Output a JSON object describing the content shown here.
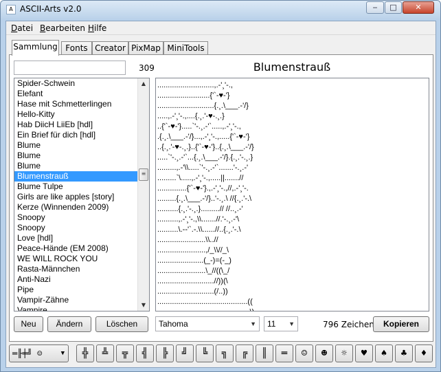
{
  "window": {
    "title": "ASCII-Arts v2.0",
    "app_icon": "A",
    "min_glyph": "‒",
    "max_glyph": "□",
    "close_glyph": "✕"
  },
  "menu": [
    "Datei",
    "Bearbeiten",
    "Hilfe"
  ],
  "tabs": [
    "Sammlung",
    "Fonts",
    "Creator",
    "PixMap",
    "MiniTools"
  ],
  "collection": {
    "search_value": "",
    "count": "309",
    "items": [
      "Spider-Schwein",
      "Elefant",
      "Hase mit Schmetterlingen",
      "Hello-Kitty",
      "Hab DiicH LiiEb [hdl]",
      "Ein Brief für dich [hdl]",
      "Blume",
      "Blume",
      "Blume",
      "Blumenstrauß",
      "Blume Tulpe",
      "Girls are like apples [story]",
      "Kerze (Winnenden 2009)",
      "Snoopy",
      "Snoopy",
      "Love [hdl]",
      "Peace-Hände (EM 2008)",
      "WE WILL ROCK YOU",
      "Rasta-Männchen",
      "Anti-Nazi",
      "Pipe",
      "Vampir-Zähne",
      "Vampire"
    ],
    "selected_index": 9,
    "scroll_up": "▲",
    "scroll_down": "▼",
    "thumb_grip": "≡"
  },
  "art": {
    "title": "Blumenstrauß",
    "text": "...........................,.-'¸'-.,\n.........................{'`-♥-'}\n...........................{.¸.\\___.-'/}\n.....,.-'¸'-.,....{.¸.'-♥-.¸.}\n..{'`-♥-'}.....`'-.¸.-'`.....,.-'¸'-.,\n.{.¸.\\___.-'/}...,.-'¸'-.,.....{'`-♥-'}\n..{.¸.'-♥-.¸.}..{'`-♥-'}..{.¸.\\___.-'/}\n.....`'-.¸.-'`...{.¸.\\___.-'/}.{.¸.'-.¸.}\n.........,.-'\\\\.....`'-.¸.-'`.......'-.¸.-'\n.........`\\.....,.-'¸'-.,.....||.......//\n..............{'`-♥-'}.,.-'¸'-.,//,.-'¸'-.\n.........{.¸.\\___.-'/}..'-.¸.\\ //{.¸.'-.\\\n..........{.¸.'-.¸.}.........// //..¸.-'\n..........,.-'¸'-.,\\\\.......//.'-.¸.-'\\\n..........\\.--'`.-.\\\\......//..{.¸.'-.\\\n.......................\\\\..//\n.......................,/_\\\\//_\\\n......................(_-)=(-_)\n.......................\\_//((\\_/\n...........................//))(\\\n...........................(/..))\n...........................................((\n............................................\\)",
    "chars": "796 Zeichen"
  },
  "buttons": {
    "new": "Neu",
    "change": "Ändern",
    "delete": "Löschen",
    "copy": "Kopieren"
  },
  "font": {
    "name": "Tahoma",
    "size": "11",
    "dropdown_arrow": "▼"
  },
  "glyph_dropdown": {
    "value": "═╟╪╝ ☺",
    "arrow": "▼"
  },
  "glyph_buttons": [
    "╬",
    "╩",
    "╦",
    "╣",
    "╠",
    "╝",
    "╚",
    "╗",
    "╔",
    "║",
    "═",
    "☺",
    "☻",
    "☼",
    "♥",
    "♠",
    "♣",
    "♦"
  ]
}
